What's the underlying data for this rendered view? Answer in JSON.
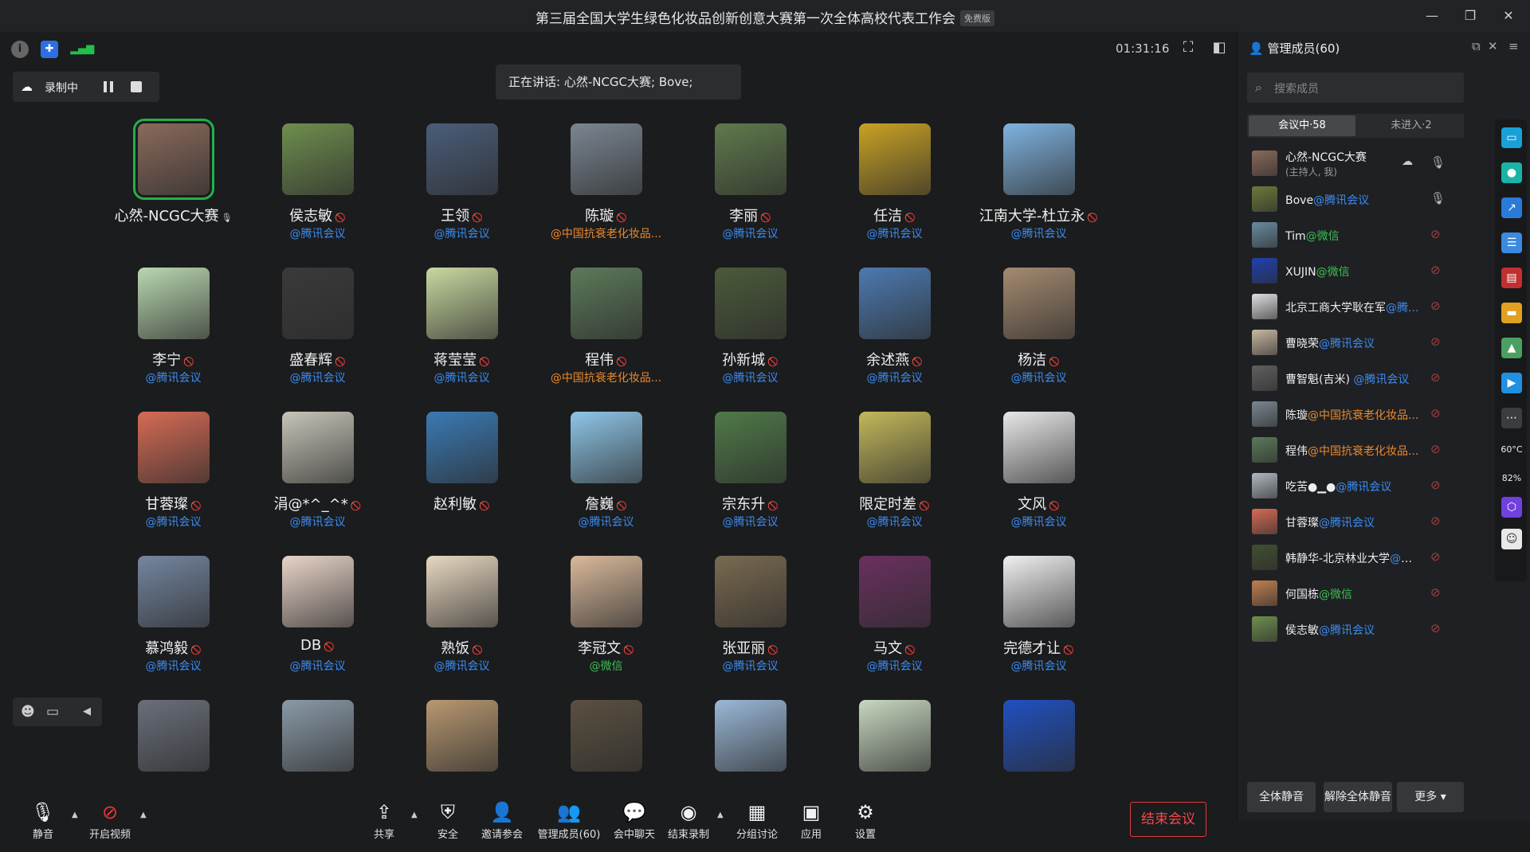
{
  "window": {
    "title": "第三届全国大学生绿色化妆品创新创意大赛第一次全体高校代表工作会",
    "badge": "免费版",
    "controls": [
      "minimize-icon",
      "restore-icon",
      "close-icon"
    ]
  },
  "topbar": {
    "timer": "01:31:16",
    "icons": [
      "info-icon",
      "shield-icon",
      "signal-icon",
      "fullscreen-icon",
      "layout-icon"
    ]
  },
  "recording": {
    "label": "录制中"
  },
  "speaking": {
    "text": "正在讲话: 心然-NCGC大赛; Bove;"
  },
  "participants": [
    {
      "name": "心然-NCGC大赛",
      "sub": "",
      "sub_color": "blue",
      "mic": "on",
      "host": true,
      "color": "#8a6a5c"
    },
    {
      "name": "侯志敏",
      "sub": "@腾讯会议",
      "sub_color": "blue",
      "mic": "off",
      "color": "#6f8e4e"
    },
    {
      "name": "王领",
      "sub": "@腾讯会议",
      "sub_color": "blue",
      "mic": "off",
      "color": "#4a5d7a"
    },
    {
      "name": "陈璇",
      "sub": "@中国抗衰老化妆品...",
      "sub_color": "orange",
      "mic": "off",
      "color": "#7b8692"
    },
    {
      "name": "李丽",
      "sub": "@腾讯会议",
      "sub_color": "blue",
      "mic": "off",
      "color": "#5f7a4c"
    },
    {
      "name": "任洁",
      "sub": "@腾讯会议",
      "sub_color": "blue",
      "mic": "off",
      "color": "#c9a224"
    },
    {
      "name": "江南大学-杜立永",
      "sub": "@腾讯会议",
      "sub_color": "blue",
      "mic": "off",
      "color": "#7fb3e0"
    },
    {
      "name": "李宁",
      "sub": "@腾讯会议",
      "sub_color": "blue",
      "mic": "off",
      "color": "#b9d8b0"
    },
    {
      "name": "盛春辉",
      "sub": "@腾讯会议",
      "sub_color": "blue",
      "mic": "off",
      "color": "#3a3a3a"
    },
    {
      "name": "蒋莹莹",
      "sub": "@腾讯会议",
      "sub_color": "blue",
      "mic": "off",
      "color": "#c8d9a0"
    },
    {
      "name": "程伟",
      "sub": "@中国抗衰老化妆品...",
      "sub_color": "orange",
      "mic": "off",
      "color": "#5c7a5a"
    },
    {
      "name": "孙新城",
      "sub": "@腾讯会议",
      "sub_color": "blue",
      "mic": "off",
      "color": "#4b5a3a"
    },
    {
      "name": "余述燕",
      "sub": "@腾讯会议",
      "sub_color": "blue",
      "mic": "off",
      "color": "#4c7ab0"
    },
    {
      "name": "杨洁",
      "sub": "@腾讯会议",
      "sub_color": "blue",
      "mic": "off",
      "color": "#a58a70"
    },
    {
      "name": "甘蓉璨",
      "sub": "@腾讯会议",
      "sub_color": "blue",
      "mic": "off",
      "color": "#d76b55"
    },
    {
      "name": "涓@*^_^*",
      "sub": "@腾讯会议",
      "sub_color": "blue",
      "mic": "off",
      "color": "#c7c5b8"
    },
    {
      "name": "赵利敏",
      "sub": "",
      "sub_color": "blue",
      "mic": "off",
      "color": "#3a7ab5"
    },
    {
      "name": "詹巍",
      "sub": "@腾讯会议",
      "sub_color": "blue",
      "mic": "off",
      "color": "#8ec6e8"
    },
    {
      "name": "宗东升",
      "sub": "@腾讯会议",
      "sub_color": "blue",
      "mic": "off",
      "color": "#4f7a48"
    },
    {
      "name": "限定时差",
      "sub": "@腾讯会议",
      "sub_color": "blue",
      "mic": "off",
      "color": "#c3b85a"
    },
    {
      "name": "文风",
      "sub": "@腾讯会议",
      "sub_color": "blue",
      "mic": "off",
      "color": "#e8e8e8"
    },
    {
      "name": "慕鸿毅",
      "sub": "@腾讯会议",
      "sub_color": "blue",
      "mic": "off",
      "color": "#7486a0"
    },
    {
      "name": "DB",
      "sub": "@腾讯会议",
      "sub_color": "blue",
      "mic": "off",
      "color": "#e9d4c8"
    },
    {
      "name": "熟饭",
      "sub": "@腾讯会议",
      "sub_color": "blue",
      "mic": "off",
      "color": "#e8d8c0"
    },
    {
      "name": "李冠文",
      "sub": "@微信",
      "sub_color": "green",
      "mic": "off",
      "color": "#d9b99b"
    },
    {
      "name": "张亚丽",
      "sub": "@腾讯会议",
      "sub_color": "blue",
      "mic": "off",
      "color": "#7a6a50"
    },
    {
      "name": "马文",
      "sub": "@腾讯会议",
      "sub_color": "blue",
      "mic": "off",
      "color": "#6a3060"
    },
    {
      "name": "完德才让",
      "sub": "@腾讯会议",
      "sub_color": "blue",
      "mic": "off",
      "color": "#f0f0f0"
    },
    {
      "name": "",
      "sub": "",
      "sub_color": "blue",
      "mic": "none",
      "color": "#6a6f7a"
    },
    {
      "name": "",
      "sub": "",
      "sub_color": "blue",
      "mic": "none",
      "color": "#8a9aa8"
    },
    {
      "name": "",
      "sub": "",
      "sub_color": "blue",
      "mic": "none",
      "color": "#b89870"
    },
    {
      "name": "",
      "sub": "",
      "sub_color": "blue",
      "mic": "none",
      "color": "#5a5040"
    },
    {
      "name": "",
      "sub": "",
      "sub_color": "blue",
      "mic": "none",
      "color": "#9ab8d8"
    },
    {
      "name": "",
      "sub": "",
      "sub_color": "blue",
      "mic": "none",
      "color": "#c8d8c0"
    },
    {
      "name": "",
      "sub": "",
      "sub_color": "blue",
      "mic": "none",
      "color": "#2050c0"
    }
  ],
  "toolbar": {
    "mute": "静音",
    "video": "开启视频",
    "share": "共享",
    "security": "安全",
    "invite": "邀请参会",
    "members": "管理成员(60)",
    "chat": "会中聊天",
    "end_record": "结束录制",
    "breakout": "分组讨论",
    "apps": "应用",
    "settings": "设置",
    "end_meeting": "结束会议"
  },
  "panel": {
    "title": "管理成员(60)",
    "search_placeholder": "搜索成员",
    "tab_in": "会议中·58",
    "tab_out": "未进入·2",
    "members": [
      {
        "name": "心然-NCGC大赛",
        "role": "(主持人, 我)",
        "suffix": "",
        "suffix_color": "blue",
        "mic": "on",
        "cloud": true,
        "color": "#8a6a5c"
      },
      {
        "name": "Bove",
        "role": "",
        "suffix": "@腾讯会议",
        "suffix_color": "blue",
        "mic": "on",
        "color": "#6a7a3a"
      },
      {
        "name": "Tim",
        "role": "",
        "suffix": "@微信",
        "suffix_color": "green",
        "mic": "off",
        "color": "#6a8aa0"
      },
      {
        "name": "XUJIN",
        "role": "",
        "suffix": "@微信",
        "suffix_color": "green",
        "mic": "off",
        "color": "#2040b0"
      },
      {
        "name": "北京工商大学耿在军",
        "role": "",
        "suffix": "@腾...",
        "suffix_color": "blue",
        "mic": "off",
        "color": "#e0e0e0"
      },
      {
        "name": "曹晓荣",
        "role": "",
        "suffix": "@腾讯会议",
        "suffix_color": "blue",
        "mic": "off",
        "color": "#c8b8a0"
      },
      {
        "name": "曹智魁(吉米) ",
        "role": "",
        "suffix": "@腾讯会议",
        "suffix_color": "blue",
        "mic": "off",
        "color": "#606060"
      },
      {
        "name": "陈璇",
        "role": "",
        "suffix": "@中国抗衰老化妆品...",
        "suffix_color": "orange",
        "mic": "off",
        "color": "#7b8692"
      },
      {
        "name": "程伟",
        "role": "",
        "suffix": "@中国抗衰老化妆品...",
        "suffix_color": "orange",
        "mic": "off",
        "color": "#5c7a5a"
      },
      {
        "name": "吃苦●▁●",
        "role": "",
        "suffix": "@腾讯会议",
        "suffix_color": "blue",
        "mic": "off",
        "color": "#b0b8c0"
      },
      {
        "name": "甘蓉璨",
        "role": "",
        "suffix": "@腾讯会议",
        "suffix_color": "blue",
        "mic": "off",
        "color": "#d76b55"
      },
      {
        "name": "韩静华-北京林业大学",
        "role": "",
        "suffix": "@腾...",
        "suffix_color": "blue",
        "mic": "off",
        "color": "#405030"
      },
      {
        "name": "何国栋",
        "role": "",
        "suffix": "@微信",
        "suffix_color": "green",
        "mic": "off",
        "color": "#c08050"
      },
      {
        "name": "侯志敏",
        "role": "",
        "suffix": "@腾讯会议",
        "suffix_color": "blue",
        "mic": "off",
        "color": "#6f8e4e"
      }
    ],
    "mute_all": "全体静音",
    "unmute_all": "解除全体静音",
    "more": "更多 ▾"
  },
  "dock": {
    "temp": "60°C",
    "cpu": "82%"
  }
}
